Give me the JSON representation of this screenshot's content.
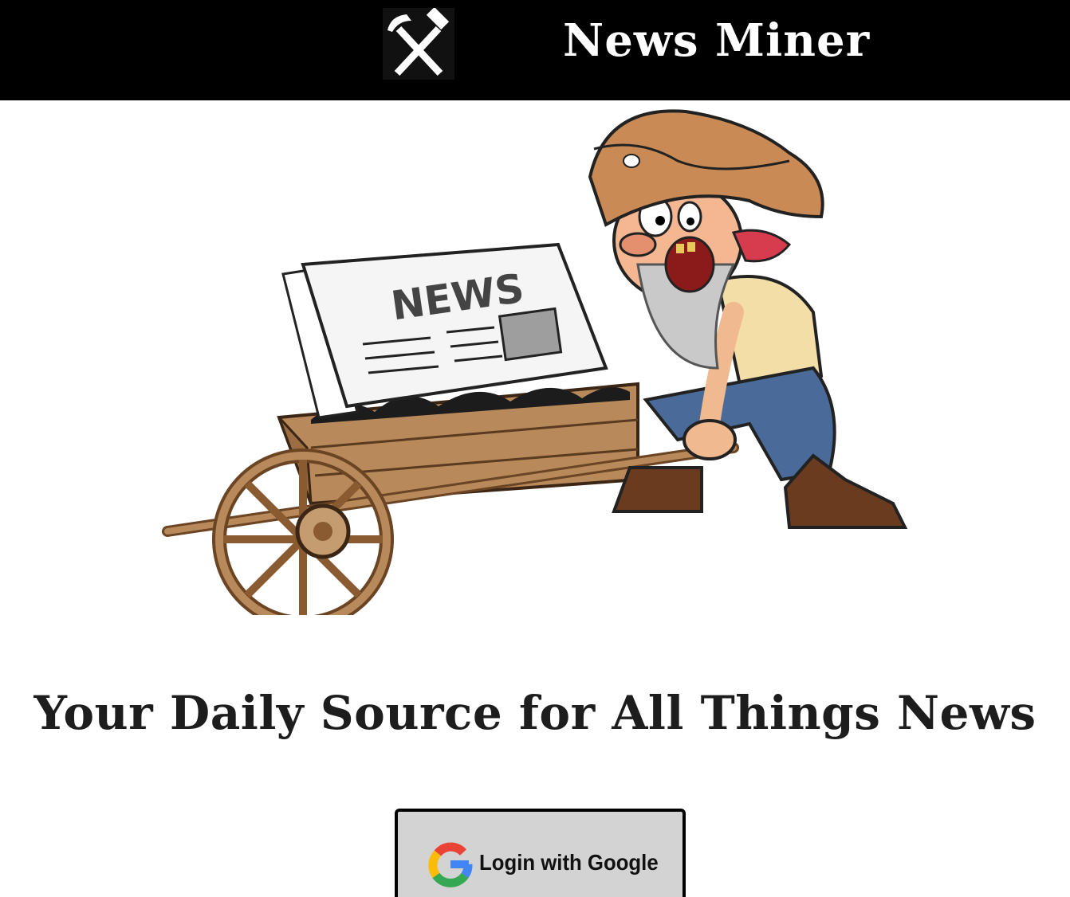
{
  "header": {
    "logo_icon": "crossed-pickaxe-hammer-icon",
    "title": "News Miner",
    "background": "#000000",
    "title_color": "#ffffff"
  },
  "hero": {
    "image": "prospector-pushing-wheelbarrow-with-newspaper",
    "newspaper_text": "NEWS"
  },
  "main": {
    "tagline": "Your Daily Source for All Things News"
  },
  "login": {
    "label": "Login with Google",
    "icon": "google-g-icon",
    "background": "#d3d3d3"
  }
}
